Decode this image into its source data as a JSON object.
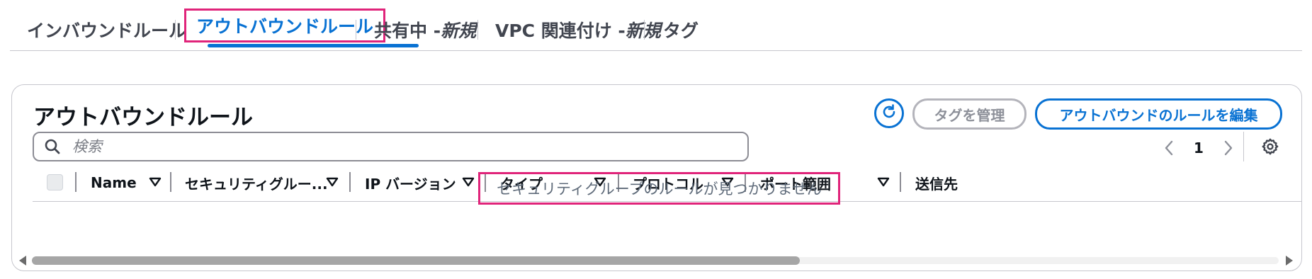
{
  "tabs": [
    {
      "label": "インバウンドルール"
    },
    {
      "label": "アウトバウンドルール"
    },
    {
      "label": "共有中 - ",
      "badge": "新規"
    },
    {
      "label": "VPC 関連付け - ",
      "badge": "新規"
    },
    {
      "label": "タグ"
    }
  ],
  "panel": {
    "title": "アウトバウンドルール",
    "manage_tags_label": "タグを管理",
    "edit_rules_label": "アウトバウンドのルールを編集",
    "search_placeholder": "検索",
    "page_number": "1",
    "columns": [
      {
        "label": "Name"
      },
      {
        "label": "セキュリティグルー..."
      },
      {
        "label": "IP バージョン"
      },
      {
        "label": "タイプ"
      },
      {
        "label": "プロトコル"
      },
      {
        "label": "ポート範囲"
      },
      {
        "label": "送信先"
      }
    ],
    "empty_message": "セキュリティグループのルールが見つかりません"
  },
  "colors": {
    "accent": "#0972d3",
    "highlight": "#e0247a",
    "disabled": "#8d9099"
  },
  "icons": [
    "refresh-icon",
    "search-icon",
    "chevron-left-icon",
    "chevron-right-icon",
    "gear-icon",
    "sort-icon"
  ]
}
